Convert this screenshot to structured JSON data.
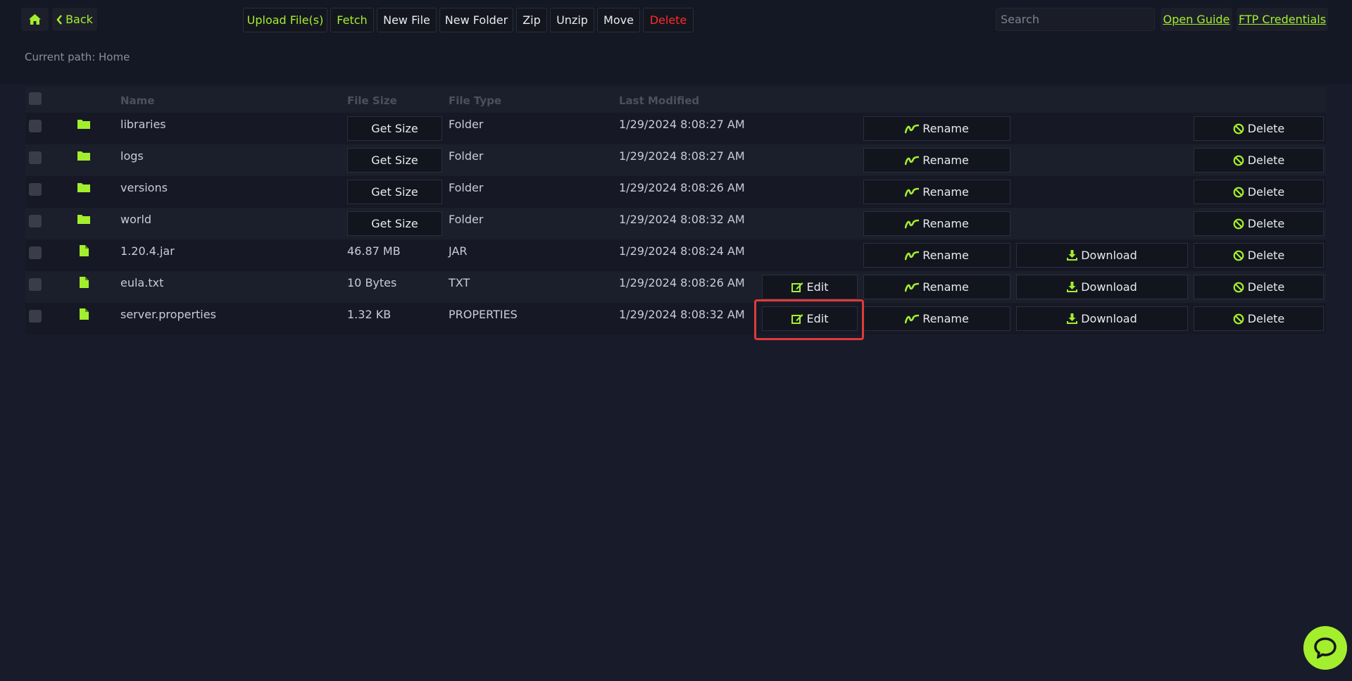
{
  "colors": {
    "accent": "#a3ef2e",
    "danger": "#ff2a2a",
    "highlight": "#e03a3a"
  },
  "nav": {
    "home_icon": "home-icon",
    "back_label": "Back"
  },
  "toolbar": {
    "upload": "Upload File(s)",
    "fetch": "Fetch",
    "new_file": "New File",
    "new_folder": "New Folder",
    "zip": "Zip",
    "unzip": "Unzip",
    "move": "Move",
    "delete": "Delete"
  },
  "search": {
    "placeholder": "Search",
    "value": ""
  },
  "links": {
    "guide": "Open Guide",
    "ftp": "FTP Credentials"
  },
  "path": {
    "text": "Current path: Home"
  },
  "table": {
    "headers": {
      "name": "Name",
      "size": "File Size",
      "type": "File Type",
      "modified": "Last Modified"
    },
    "actions": {
      "get_size": "Get Size",
      "edit": "Edit",
      "rename": "Rename",
      "download": "Download",
      "delete": "Delete"
    },
    "rows": [
      {
        "name": "libraries",
        "size": "",
        "type": "Folder",
        "modified": "1/29/2024 8:08:27 AM",
        "icon": "folder-icon"
      },
      {
        "name": "logs",
        "size": "",
        "type": "Folder",
        "modified": "1/29/2024 8:08:27 AM",
        "icon": "folder-icon"
      },
      {
        "name": "versions",
        "size": "",
        "type": "Folder",
        "modified": "1/29/2024 8:08:26 AM",
        "icon": "folder-icon"
      },
      {
        "name": "world",
        "size": "",
        "type": "Folder",
        "modified": "1/29/2024 8:08:32 AM",
        "icon": "folder-icon"
      },
      {
        "name": "1.20.4.jar",
        "size": "46.87 MB",
        "type": "JAR",
        "modified": "1/29/2024 8:08:24 AM",
        "icon": "file-icon"
      },
      {
        "name": "eula.txt",
        "size": "10 Bytes",
        "type": "TXT",
        "modified": "1/29/2024 8:08:26 AM",
        "icon": "file-icon"
      },
      {
        "name": "server.properties",
        "size": "1.32 KB",
        "type": "PROPERTIES",
        "modified": "1/29/2024 8:08:32 AM",
        "icon": "file-icon"
      }
    ]
  },
  "chat": {
    "icon": "chat-bubble-icon"
  }
}
